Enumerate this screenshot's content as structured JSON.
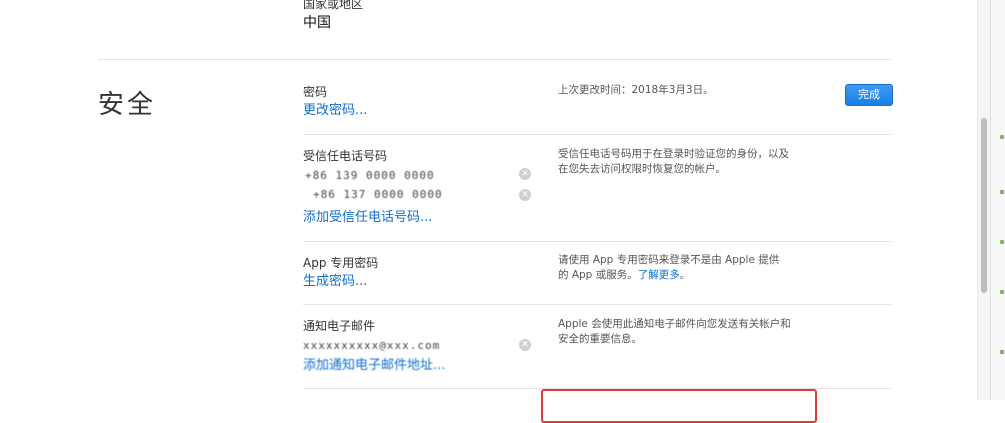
{
  "region": {
    "label": "国家或地区",
    "value": "中国"
  },
  "security": {
    "title": "安全",
    "done_label": "完成",
    "password": {
      "label": "密码",
      "link": "更改密码...",
      "desc": "上次更改时间：2018年3月3日。"
    },
    "trusted_phone": {
      "label": "受信任电话号码",
      "numbers": [
        "+86 139 0000 0000",
        "+86 137 0000 0000"
      ],
      "link": "添加受信任电话号码...",
      "desc": "受信任电话号码用于在登录时验证您的身份，以及在您失去访问权限时恢复您的帐户。"
    },
    "app_password": {
      "label": "App 专用密码",
      "link": "生成密码...",
      "desc_prefix": "请使用 App 专用密码来登录不是由 Apple 提供的 App 或服务。",
      "desc_link": "了解更多",
      "desc_suffix": "。"
    },
    "notification_email": {
      "label": "通知电子邮件",
      "email": "xxxxxxxxxx@xxx.com",
      "link": "添加通知电子邮件地址...",
      "desc": "Apple 会使用此通知电子邮件向您发送有关帐户和安全的重要信息。"
    }
  },
  "colors": {
    "accent": "#0f6fcf",
    "highlight_box": "#e03b3b"
  }
}
